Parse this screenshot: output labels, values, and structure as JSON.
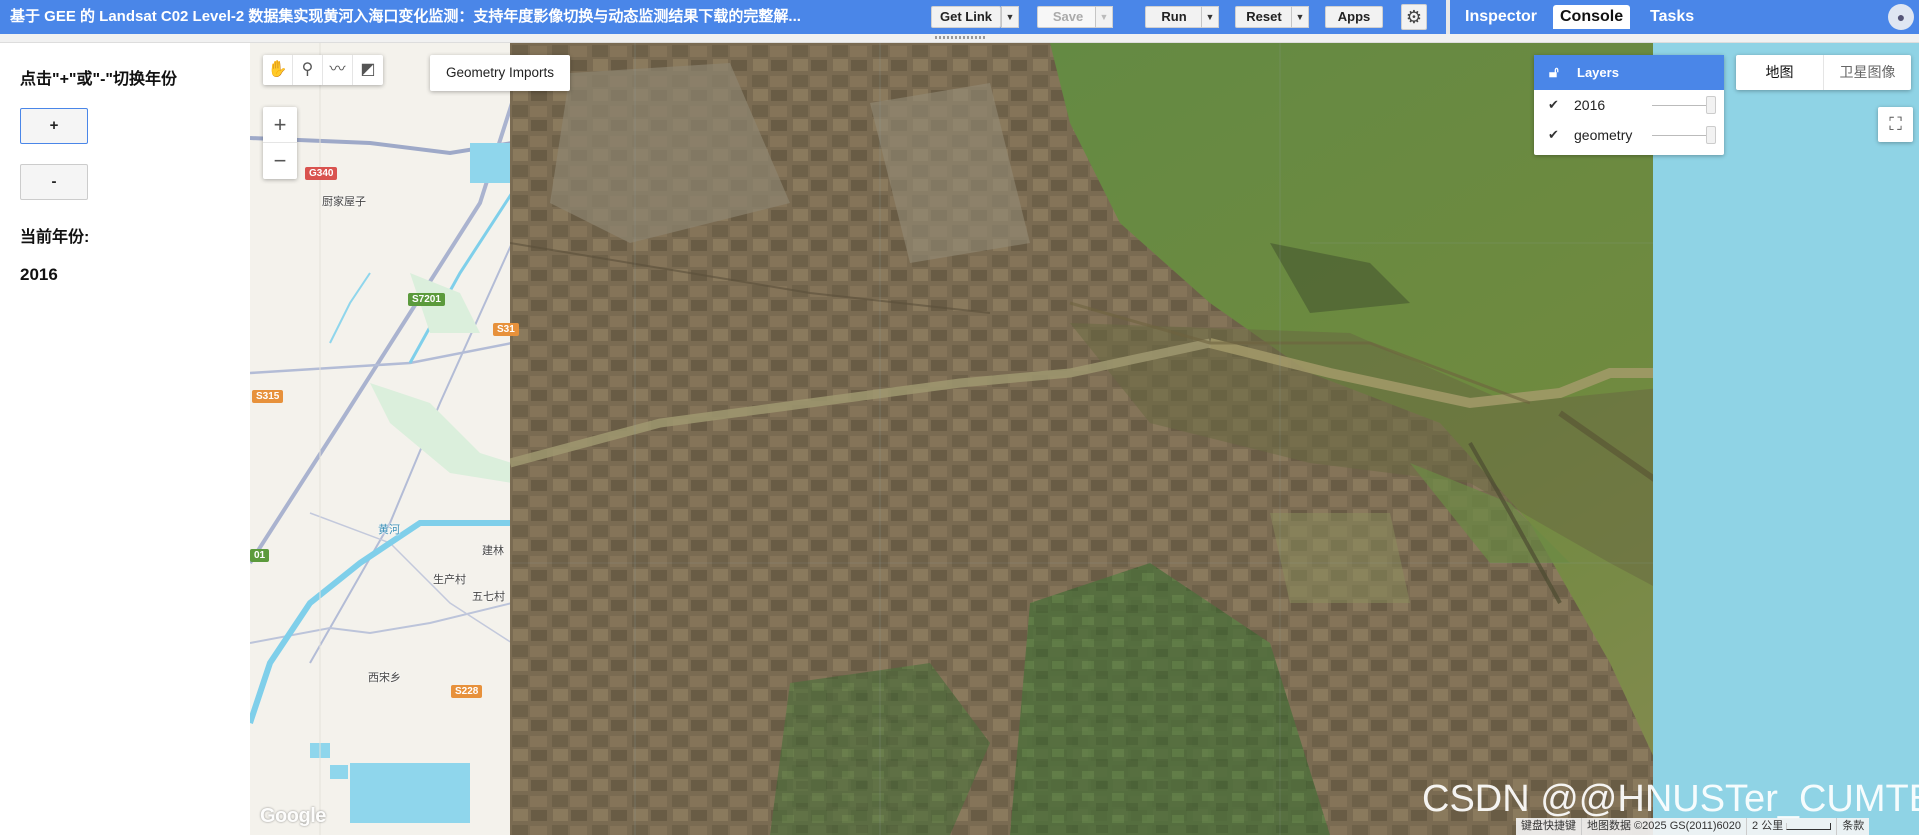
{
  "topbar": {
    "title": "基于 GEE 的 Landsat C02 Level-2 数据集实现黄河入海口变化监测：支持年度影像切换与动态监测结果下载的完整解...",
    "get_link": "Get Link",
    "save": "Save",
    "run": "Run",
    "reset": "Reset",
    "apps": "Apps",
    "tabs": [
      "Inspector",
      "Console",
      "Tasks"
    ],
    "active_tab": "Console"
  },
  "panel": {
    "instruction": "点击\"+\"或\"-\"切换年份",
    "plus_label": "+",
    "minus_label": "-",
    "year_label": "当前年份:",
    "year_value": "2016"
  },
  "map": {
    "geometry_imports": "Geometry Imports",
    "zoom_in": "+",
    "zoom_out": "−",
    "layers_title": "Layers",
    "layers": [
      {
        "name": "2016",
        "checked": true
      },
      {
        "name": "geometry",
        "checked": true
      }
    ],
    "map_type": {
      "map": "地图",
      "satellite": "卫星图像"
    },
    "labels": {
      "village1": "厨家屋子",
      "village2": "生产村",
      "village3": "五七村",
      "village4": "西宋乡",
      "village5": "建林",
      "river": "黄河"
    },
    "roads": {
      "g340": "G340",
      "s7201": "S7201",
      "s31": "S31",
      "s315": "S315",
      "s228": "S228",
      "r01": "01"
    },
    "google": "Google",
    "attribution": {
      "shortcuts": "键盘快捷键",
      "data": "地图数据 ©2025 GS(2011)6020",
      "scale": "2 公里",
      "terms": "条款"
    },
    "watermark": "CSDN @@HNUSTer_CUMTBer"
  },
  "colors": {
    "accent": "#4a86e8",
    "water": "#8fd3e5"
  }
}
